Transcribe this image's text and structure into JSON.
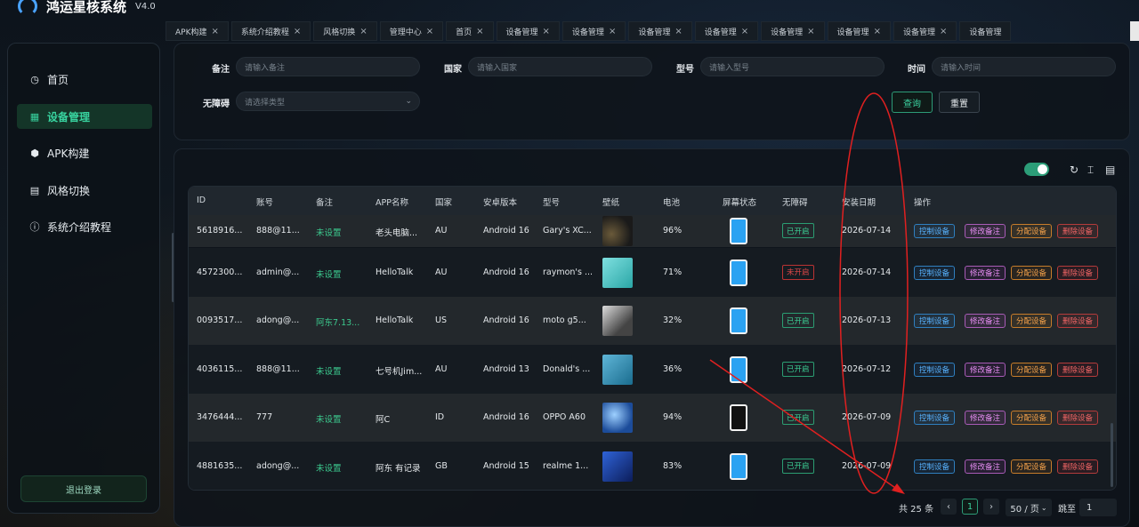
{
  "app": {
    "title": "鸿运星核系统",
    "version": "V4.0"
  },
  "sidebar": {
    "items": [
      {
        "label": "首页",
        "icon": "clock-icon"
      },
      {
        "label": "设备管理",
        "icon": "grid-icon"
      },
      {
        "label": "APK构建",
        "icon": "box-icon"
      },
      {
        "label": "风格切换",
        "icon": "file-icon"
      },
      {
        "label": "系统介绍教程",
        "icon": "info-icon"
      }
    ],
    "logout": "退出登录"
  },
  "tabs": [
    {
      "label": "APK构建"
    },
    {
      "label": "系统介绍教程"
    },
    {
      "label": "风格切换"
    },
    {
      "label": "管理中心"
    },
    {
      "label": "首页"
    },
    {
      "label": "设备管理"
    },
    {
      "label": "设备管理"
    },
    {
      "label": "设备管理"
    },
    {
      "label": "设备管理"
    },
    {
      "label": "设备管理"
    },
    {
      "label": "设备管理"
    },
    {
      "label": "设备管理"
    },
    {
      "label": "设备管理"
    }
  ],
  "filters": {
    "note": {
      "label": "备注",
      "placeholder": "请输入备注"
    },
    "country": {
      "label": "国家",
      "placeholder": "请输入国家"
    },
    "model": {
      "label": "型号",
      "placeholder": "请输入型号"
    },
    "time": {
      "label": "时间",
      "placeholder": "请输入时间"
    },
    "accessible": {
      "label": "无障碍",
      "placeholder": "请选择类型"
    },
    "query": "查询",
    "reset": "重置"
  },
  "table": {
    "headers": [
      "ID",
      "账号",
      "备注",
      "APP名称",
      "国家",
      "安卓版本",
      "型号",
      "壁纸",
      "电池",
      "屏幕状态",
      "无障碍",
      "安装日期",
      "操作"
    ],
    "actions": [
      "控制设备",
      "修改备注",
      "分配设备",
      "删除设备"
    ],
    "rows": [
      {
        "id": "5618916...",
        "account": "888@11...",
        "note": "未设置",
        "app": "老头电脑...",
        "country": "AU",
        "android": "Android 16",
        "model": "Gary's XC...",
        "battery": "96%",
        "screen": "on",
        "access": "已开启",
        "access_on": true,
        "date": "2026-07-14"
      },
      {
        "id": "4572300...",
        "account": "admin@...",
        "note": "未设置",
        "app": "HelloTalk",
        "country": "AU",
        "android": "Android 16",
        "model": "raymon's ...",
        "battery": "71%",
        "screen": "on",
        "access": "未开启",
        "access_on": false,
        "date": "2026-07-14"
      },
      {
        "id": "0093517...",
        "account": "adong@...",
        "note": "阿东7.13...",
        "app": "HelloTalk",
        "country": "US",
        "android": "Android 16",
        "model": "moto g5...",
        "battery": "32%",
        "screen": "on",
        "access": "已开启",
        "access_on": true,
        "date": "2026-07-13"
      },
      {
        "id": "4036115...",
        "account": "888@11...",
        "note": "未设置",
        "app": "七号机Jim...",
        "country": "AU",
        "android": "Android 13",
        "model": "Donald's ...",
        "battery": "36%",
        "screen": "on",
        "access": "已开启",
        "access_on": true,
        "date": "2026-07-12"
      },
      {
        "id": "3476444...",
        "account": "777",
        "note": "未设置",
        "app": "阿C",
        "country": "ID",
        "android": "Android 16",
        "model": "OPPO A60",
        "battery": "94%",
        "screen": "off",
        "access": "已开启",
        "access_on": true,
        "date": "2026-07-09"
      },
      {
        "id": "4881635...",
        "account": "adong@...",
        "note": "未设置",
        "app": "阿东 有记录",
        "country": "GB",
        "android": "Android 15",
        "model": "realme 1...",
        "battery": "83%",
        "screen": "on",
        "access": "已开启",
        "access_on": true,
        "date": "2026-07-09"
      }
    ]
  },
  "pagination": {
    "total": "共 25 条",
    "current": "1",
    "size": "50 / 页",
    "jump_label": "跳至",
    "jump_value": "1"
  }
}
